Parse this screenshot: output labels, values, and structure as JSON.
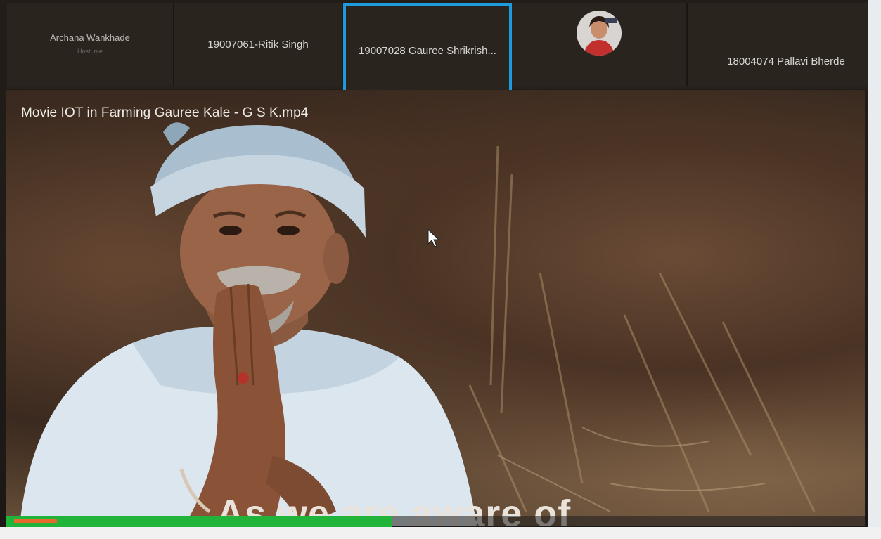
{
  "participants": [
    {
      "name": "Archana Wankhade",
      "sub": "Host, me"
    },
    {
      "name": "19007061-Ritik Singh"
    },
    {
      "name": "19007028 Gauree Shrikrish..."
    },
    {
      "name": ""
    },
    {
      "name": "18004074 Pallavi Bherde"
    }
  ],
  "video": {
    "title": "Movie IOT in Farming Gauree Kale - G S K.mp4",
    "caption": "As we are aware of",
    "progress_fraction": 0.05
  },
  "icons": {
    "avatar": "participant-avatar",
    "cursor": "mouse-cursor-icon",
    "play": "play-icon"
  },
  "colors": {
    "active_speaker": "#1e9bdc",
    "progress": "#21b43a",
    "played": "#e46a2e"
  }
}
